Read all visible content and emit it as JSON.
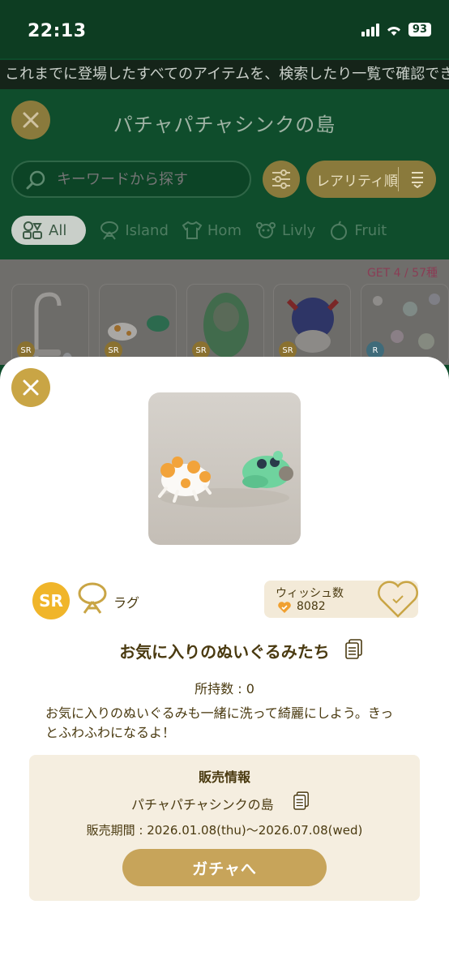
{
  "status_bar": {
    "time": "22:13",
    "battery": "93"
  },
  "announcement": "これまでに登場したすべてのアイテムを、検索したり一覧で確認でき",
  "header": {
    "title": "パチャパチャシンクの島",
    "search_placeholder": "キーワードから探す",
    "sort_label": "レアリティ順"
  },
  "tabs": [
    {
      "label": "All",
      "icon": "all-items-icon",
      "active": true
    },
    {
      "label": "Island",
      "icon": "island-icon"
    },
    {
      "label": "Hom",
      "icon": "shirt-icon"
    },
    {
      "label": "Livly",
      "icon": "livly-icon"
    },
    {
      "label": "Fruit",
      "icon": "fruit-icon"
    }
  ],
  "collection": {
    "get_count": "GET 4 / 57種"
  },
  "grid_items": [
    {
      "rarity": "SR"
    },
    {
      "rarity": "SR"
    },
    {
      "rarity": "SR"
    },
    {
      "rarity": "SR"
    },
    {
      "rarity": "R"
    }
  ],
  "detail": {
    "rarity": "SR",
    "category_icon": "rug-icon",
    "category": "ラグ",
    "wish_label": "ウィッシュ数",
    "wish_count": "8082",
    "name": "お気に入りのぬいぐるみたち",
    "owned": "所持数 : 0",
    "description": "お気に入りのぬいぐるみも一緒に洗って綺麗にしよう。きっとふわふわになるよ！",
    "sale": {
      "title": "販売情報",
      "gacha_name": "パチャパチャシンクの島",
      "period": "販売期間 : 2026.01.08(thu)〜2026.07.08(wed)",
      "button": "ガチャへ"
    }
  },
  "colors": {
    "gold": "#c9a545",
    "rarity_sr": "#f0b52a",
    "text": "#4a3a10",
    "sale_bg": "#f5eee0"
  }
}
